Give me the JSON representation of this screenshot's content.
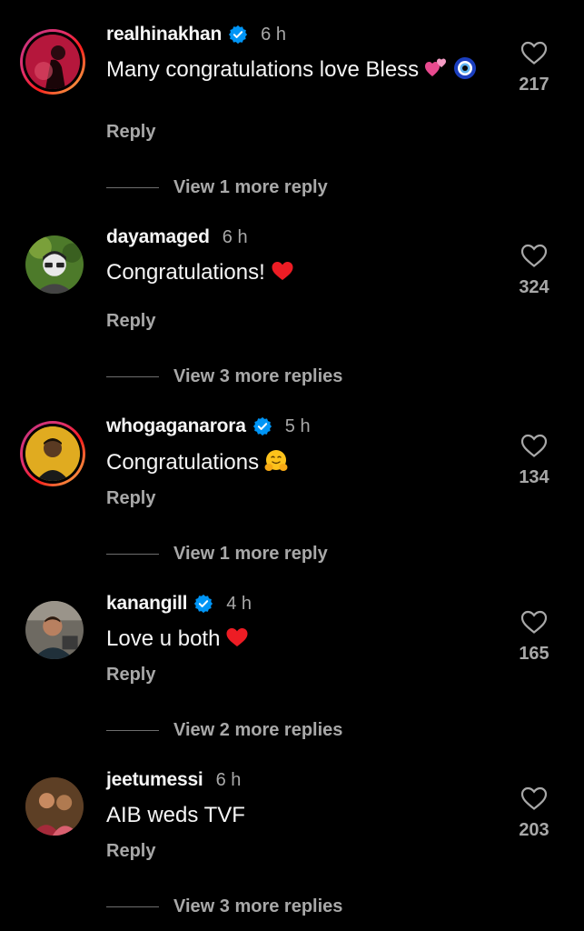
{
  "comments": [
    {
      "username": "realhinakhan",
      "verified": true,
      "time": "6 h",
      "text": "Many congratulations love Bless",
      "emojis": [
        "two-hearts",
        "nazar-amulet"
      ],
      "reply_label": "Reply",
      "likes": "217",
      "view_replies": "View 1 more reply",
      "story_ring": true
    },
    {
      "username": "dayamaged",
      "verified": false,
      "time": "6 h",
      "text": "Congratulations!",
      "emojis": [
        "red-heart"
      ],
      "reply_label": "Reply",
      "likes": "324",
      "view_replies": "View 3 more replies",
      "story_ring": false
    },
    {
      "username": "whogaganarora",
      "verified": true,
      "time": "5 h",
      "text": "Congratulations",
      "emojis": [
        "hugging-face"
      ],
      "reply_label": "Reply",
      "likes": "134",
      "view_replies": "View 1 more reply",
      "story_ring": true
    },
    {
      "username": "kanangill",
      "verified": true,
      "time": "4 h",
      "text": "Love u both",
      "emojis": [
        "red-heart"
      ],
      "reply_label": "Reply",
      "likes": "165",
      "view_replies": "View 2 more replies",
      "story_ring": false
    },
    {
      "username": "jeetumessi",
      "verified": false,
      "time": "6 h",
      "text": "AIB weds TVF",
      "emojis": [],
      "reply_label": "Reply",
      "likes": "203",
      "view_replies": "View 3 more replies",
      "story_ring": false
    }
  ],
  "colors": {
    "background": "#000000",
    "primary_text": "#f5f5f5",
    "secondary_text": "#a8a8a8",
    "verified_blue": "#0095f6",
    "heart_red": "#ed1c24"
  }
}
